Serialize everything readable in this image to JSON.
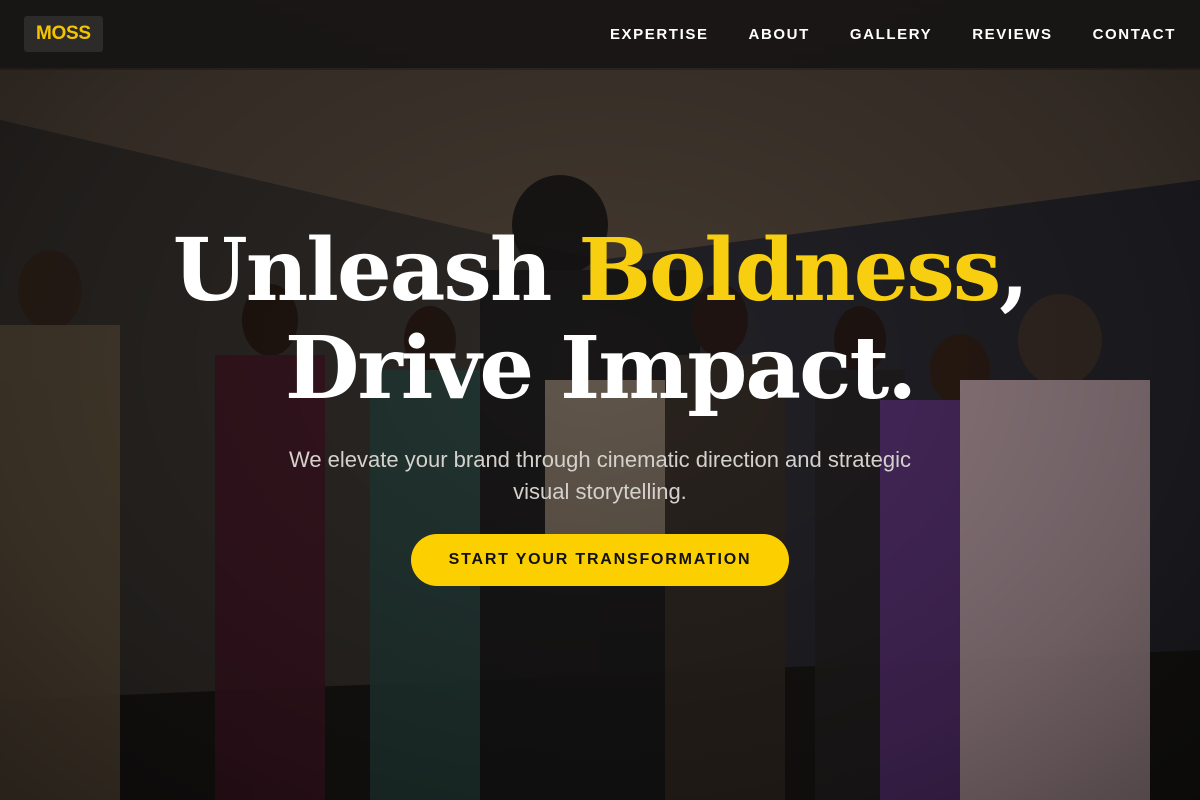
{
  "brand": {
    "logo_text": "MOSS"
  },
  "nav": {
    "items": [
      {
        "label": "EXPERTISE"
      },
      {
        "label": "ABOUT"
      },
      {
        "label": "GALLERY"
      },
      {
        "label": "REVIEWS"
      },
      {
        "label": "CONTACT"
      }
    ]
  },
  "hero": {
    "headline_part1": "Unleash ",
    "headline_accent": "Boldness",
    "headline_part2": ",",
    "headline_line2": "Drive Impact.",
    "subtitle": "We elevate your brand through cinematic direction and strategic visual storytelling.",
    "cta_label": "START YOUR TRANSFORMATION"
  },
  "colors": {
    "accent": "#f7cf10",
    "button": "#fcd000",
    "navbar_bg": "#181614",
    "text": "#ffffff"
  }
}
